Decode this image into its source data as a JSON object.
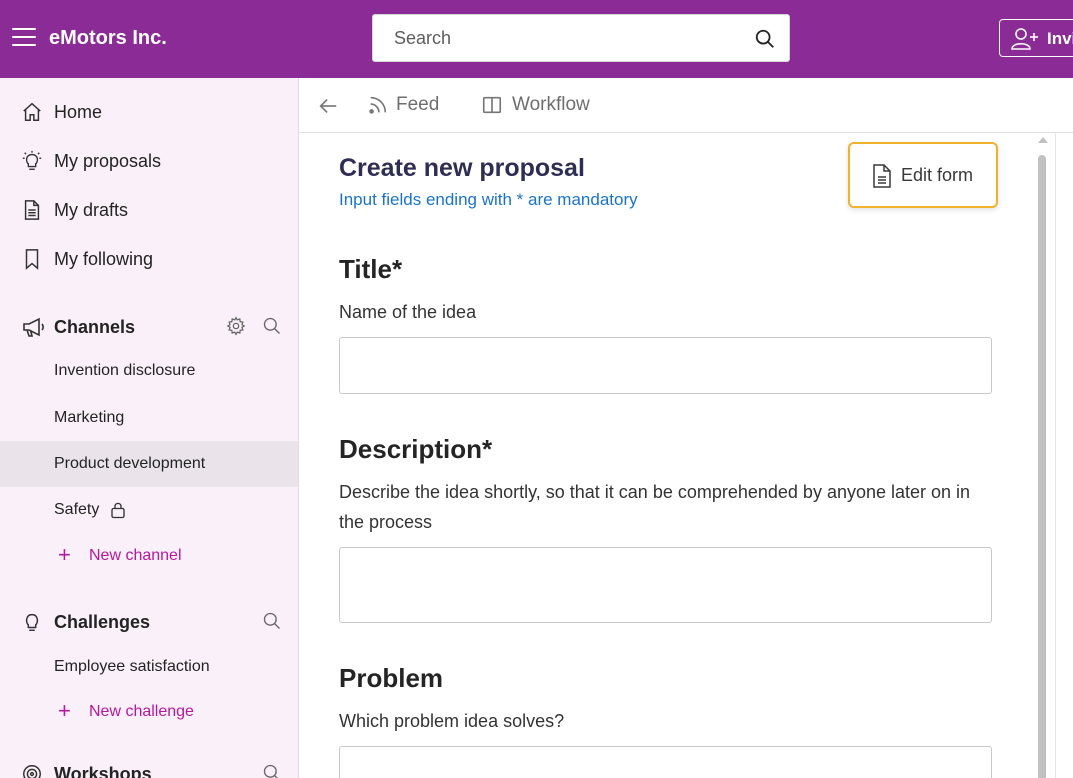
{
  "header": {
    "brand": "eMotors Inc.",
    "search_placeholder": "Search",
    "invite_label": "Invi"
  },
  "sidebar": {
    "nav": [
      {
        "label": "Home",
        "icon": "home-icon"
      },
      {
        "label": "My proposals",
        "icon": "lightbulb-icon"
      },
      {
        "label": "My drafts",
        "icon": "document-icon"
      },
      {
        "label": "My following",
        "icon": "bookmark-icon"
      }
    ],
    "channels": {
      "title": "Channels",
      "items": [
        {
          "label": "Invention disclosure",
          "active": false
        },
        {
          "label": "Marketing",
          "active": false
        },
        {
          "label": "Product development",
          "active": true
        },
        {
          "label": "Safety",
          "active": false,
          "locked": true
        }
      ],
      "add_label": "New channel"
    },
    "challenges": {
      "title": "Challenges",
      "items": [
        {
          "label": "Employee satisfaction"
        }
      ],
      "add_label": "New challenge"
    },
    "workshops": {
      "title": "Workshops"
    }
  },
  "tabs": [
    {
      "label": "Feed",
      "icon": "rss-feed-icon"
    },
    {
      "label": "Workflow",
      "icon": "columns-icon"
    }
  ],
  "form": {
    "title": "Create new proposal",
    "subtitle": "Input fields ending with * are mandatory",
    "edit_form_label": "Edit form",
    "fields": [
      {
        "title": "Title*",
        "description": "Name of the idea",
        "value": ""
      },
      {
        "title": "Description*",
        "description": "Describe the idea shortly, so that it can be comprehended by anyone later on in the process",
        "value": ""
      },
      {
        "title": "Problem",
        "description": "Which problem idea solves?",
        "value": ""
      }
    ]
  },
  "colors": {
    "header_bg": "#8b2b96",
    "sidebar_bg": "#f9f0f9",
    "accent_link": "#b4189e",
    "subtitle_blue": "#1a73c8",
    "highlight_border": "#f0b12d"
  }
}
